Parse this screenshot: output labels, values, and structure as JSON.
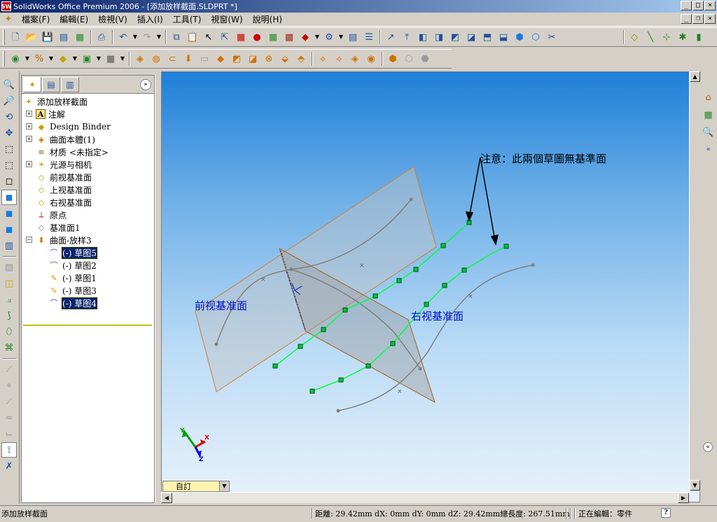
{
  "window": {
    "title": "SolidWorks Office Premium 2006 - [添加放样截面.SLDPRT *]",
    "app_badge": "SW"
  },
  "menu": [
    "檔案(F)",
    "編輯(E)",
    "檢視(V)",
    "插入(I)",
    "工具(T)",
    "視窗(W)",
    "說明(H)"
  ],
  "feature_manager": {
    "root": "添加放样截面",
    "items": [
      {
        "label": "注解",
        "icon": "annotation-icon",
        "expandable": true
      },
      {
        "label": "Design Binder",
        "icon": "design-binder-icon",
        "expandable": true
      },
      {
        "label": "曲面本體(1)",
        "icon": "surface-body-icon",
        "expandable": true
      },
      {
        "label": "材质 <未指定>",
        "icon": "material-icon",
        "expandable": false
      },
      {
        "label": "光源与相机",
        "icon": "lights-cameras-icon",
        "expandable": true
      },
      {
        "label": "前视基准面",
        "icon": "plane-icon",
        "expandable": false
      },
      {
        "label": "上视基准面",
        "icon": "plane-icon",
        "expandable": false
      },
      {
        "label": "右视基准面",
        "icon": "plane-icon",
        "expandable": false
      },
      {
        "label": "原点",
        "icon": "origin-icon",
        "expandable": false
      },
      {
        "label": "基准面1",
        "icon": "plane-icon",
        "expandable": false
      },
      {
        "label": "曲面-放样3",
        "icon": "loft-surface-icon",
        "expandable": true,
        "expanded": true
      }
    ],
    "sketches": [
      {
        "label": "(-) 草图5",
        "selected": true
      },
      {
        "label": "(-) 草图2",
        "selected": false
      },
      {
        "label": "(-) 草图1",
        "selected": false
      },
      {
        "label": "(-) 草图3",
        "selected": false
      },
      {
        "label": "(-) 草图4",
        "selected": true
      }
    ]
  },
  "viewport": {
    "annotation_note": "注意：此兩個草圖無基準面",
    "front_plane_label": "前视基准面",
    "right_plane_label": "右视基准面",
    "triad": {
      "x": "X",
      "y": "Y",
      "z": "Z"
    },
    "colors": {
      "highlight_curve": "#00ff40",
      "sketch_curve": "#808080",
      "plane_edge": "#c87828",
      "plane_fill": "#b4b4b4",
      "label_text": "#0010c0",
      "axis_x": "#e00000",
      "axis_y": "#00a000",
      "axis_z": "#0000e0"
    }
  },
  "configuration": {
    "value": "自訂"
  },
  "statusbar": {
    "left": "添加放样截面",
    "measurement": "距離: 29.42mm   dX: 0mm  dY: 0mm  dZ: 29.42mm總長度: 267.51mm",
    "edit_state": "正在編輯：零件",
    "help": "?"
  }
}
